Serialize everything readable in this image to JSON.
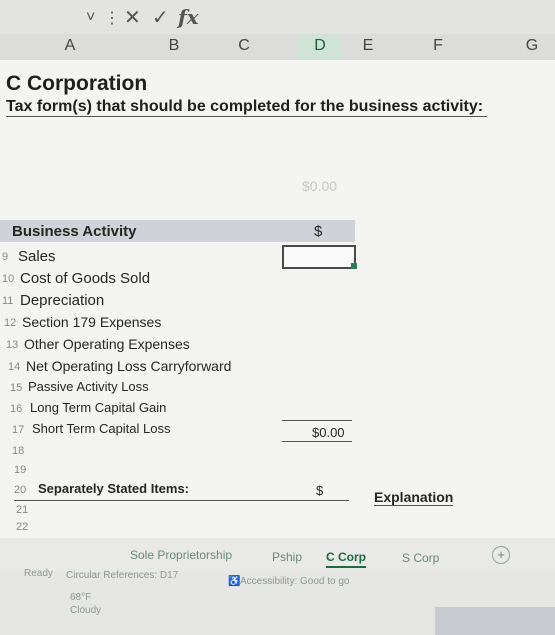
{
  "formula_bar": {
    "dropdown_glyph": "˅",
    "more_glyph": "⋮",
    "cancel_glyph": "✕",
    "enter_glyph": "✓",
    "fx_label": "fx"
  },
  "columns": [
    "A",
    "B",
    "C",
    "D",
    "E",
    "F",
    "G"
  ],
  "sheet": {
    "title": "C Corporation",
    "subtitle": "Tax form(s) that should be completed for the business activity:",
    "ghost_value": "$0.00",
    "activity_header": "Business Activity",
    "dollar_sign": "$",
    "rows": [
      {
        "num": "9",
        "label": "Sales"
      },
      {
        "num": "10",
        "label": "Cost of Goods Sold"
      },
      {
        "num": "11",
        "label": "Depreciation"
      },
      {
        "num": "12",
        "label": "Section 179 Expenses"
      },
      {
        "num": "13",
        "label": "Other Operating Expenses"
      },
      {
        "num": "14",
        "label": "Net Operating Loss Carryforward"
      },
      {
        "num": "15",
        "label": "Passive Activity Loss"
      },
      {
        "num": "16",
        "label": "Long Term Capital Gain"
      },
      {
        "num": "17",
        "label": "Short Term Capital Loss"
      }
    ],
    "total_value": "$0.00",
    "empty_rows": [
      "18",
      "19"
    ],
    "separately_row_num": "20",
    "separately_label": "Separately Stated Items:",
    "separately_dollar": "$",
    "explanation_label": "Explanation",
    "tail_rows": [
      "21",
      "22"
    ]
  },
  "tabs": [
    {
      "label": "Sole Proprietorship",
      "active": false
    },
    {
      "label": "Pship",
      "active": false
    },
    {
      "label": "C Corp",
      "active": true
    },
    {
      "label": "S Corp",
      "active": false
    }
  ],
  "add_sheet_glyph": "+",
  "status": {
    "ready": "Ready",
    "circular": "Circular References: D17",
    "accessibility": "Accessibility: Good to go",
    "temp": "68°F",
    "weather": "Cloudy"
  },
  "colors": {
    "accent": "#217346",
    "band": "#cfd2d8"
  }
}
